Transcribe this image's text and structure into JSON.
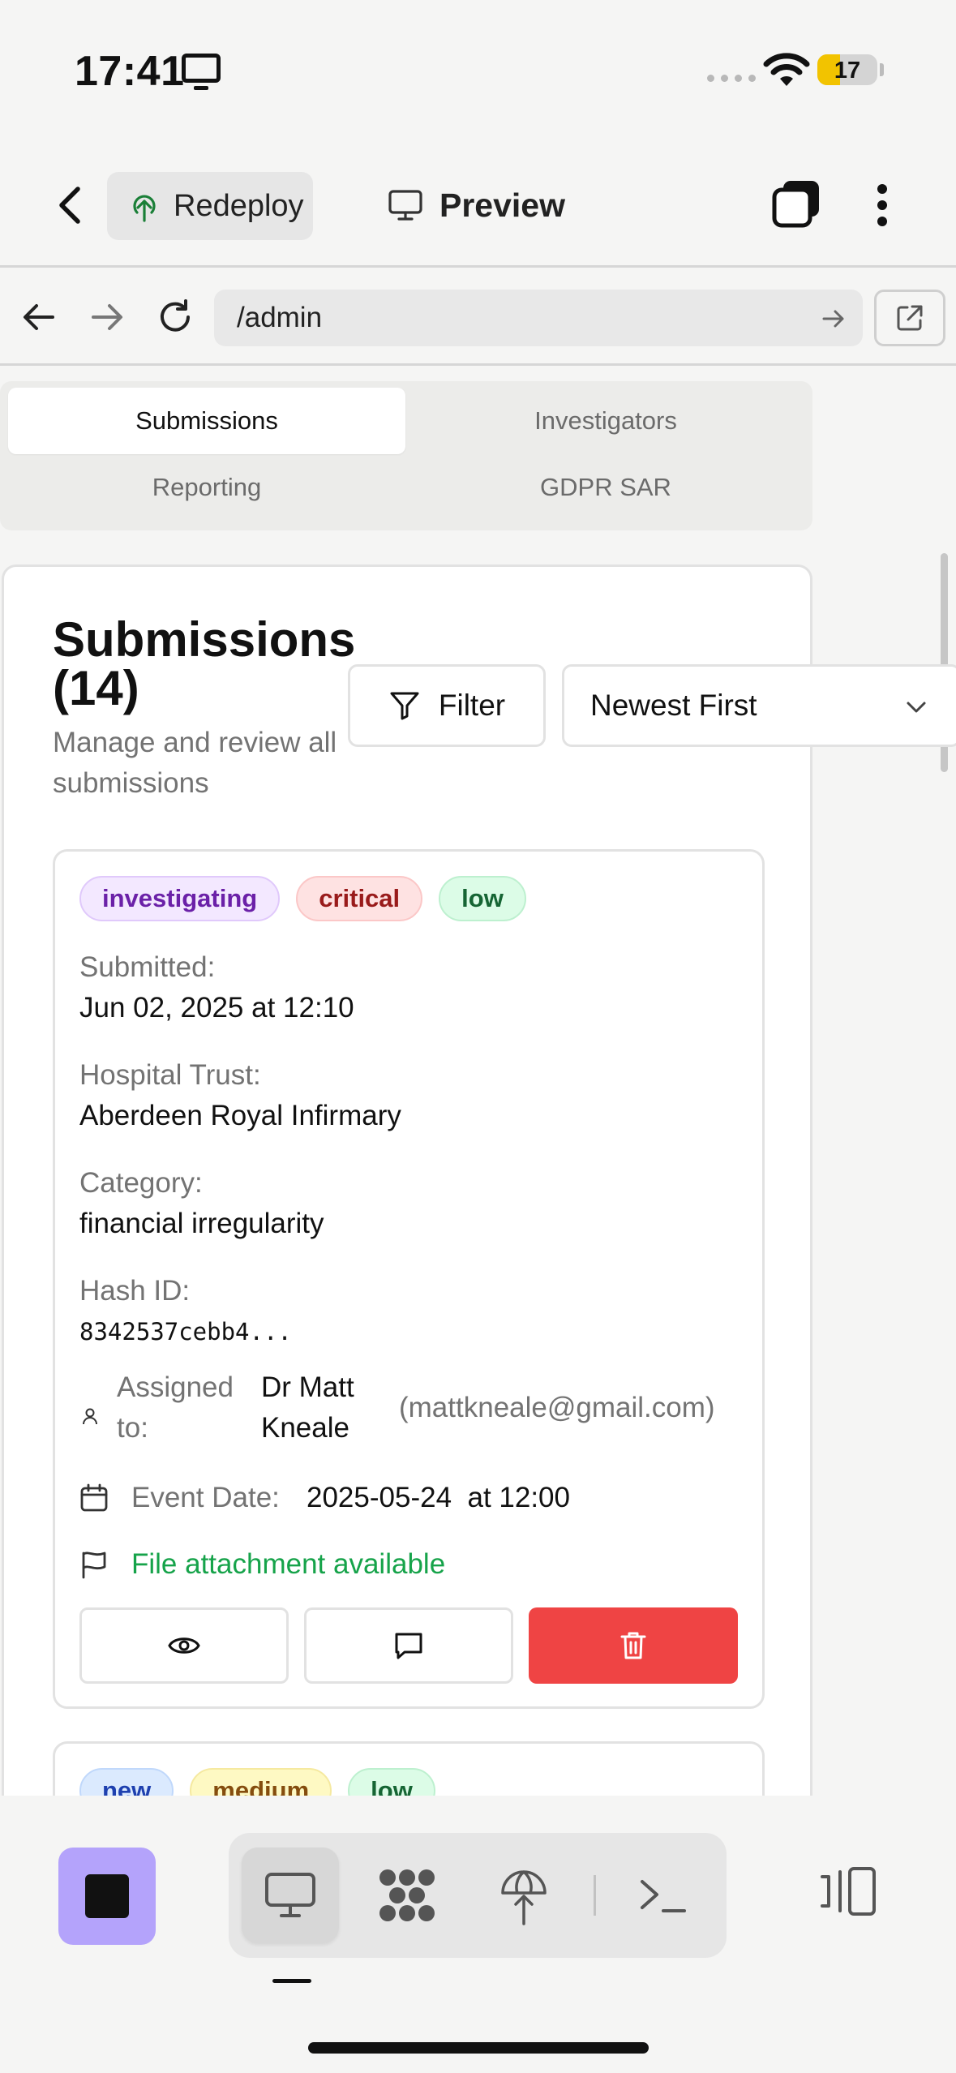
{
  "status_bar": {
    "time": "17:41",
    "battery": "17",
    "battery_fraction": 0.17
  },
  "app_bar": {
    "redeploy_label": "Redeploy",
    "preview_label": "Preview"
  },
  "url_bar": {
    "url": "/admin"
  },
  "tabs": [
    {
      "label": "Submissions",
      "active": true
    },
    {
      "label": "Investigators",
      "active": false
    },
    {
      "label": "Reporting",
      "active": false
    },
    {
      "label": "GDPR SAR",
      "active": false
    }
  ],
  "panel": {
    "title": "Submissions (14)",
    "subtitle": "Manage and review all submissions",
    "filter_label": "Filter",
    "sort_value": "Newest First"
  },
  "submissions": [
    {
      "badges": [
        "investigating",
        "critical",
        "low"
      ],
      "submitted_label": "Submitted:",
      "submitted_value": "Jun 02, 2025 at 12:10",
      "trust_label": "Hospital Trust:",
      "trust_value": "Aberdeen Royal Infirmary",
      "category_label": "Category:",
      "category_value": "financial irregularity",
      "hash_label": "Hash ID:",
      "hash_value": "8342537cebb4...",
      "assigned_label": "Assigned to:",
      "assigned_name": "Dr Matt Kneale",
      "assigned_email": "(mattkneale@gmail.com)",
      "event_label": "Event Date:",
      "event_value": "2025-05-24  at 12:00",
      "attachment_text": "File attachment available"
    },
    {
      "badges": [
        "new",
        "medium",
        "low"
      ]
    }
  ],
  "colors": {
    "accent_purple": "#b4a3fb",
    "danger": "#ef4444",
    "success_text": "#16a34a"
  },
  "icons": {
    "redeploy": "tree-upload-icon",
    "preview": "monitor-icon",
    "toolbar": [
      "stop-icon",
      "monitor-icon",
      "apps-grid-icon",
      "deploy-icon",
      "terminal-icon",
      "side-panel-icon"
    ]
  }
}
